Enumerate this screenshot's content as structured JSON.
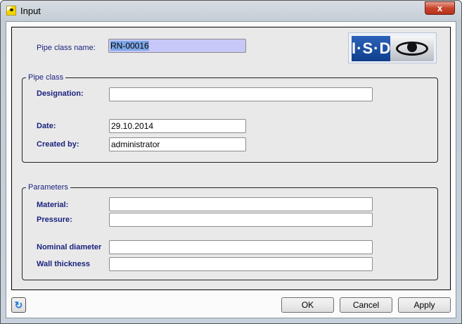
{
  "window": {
    "title": "Input",
    "close": "x"
  },
  "header": {
    "pipe_class_name_label": "Pipe class name:",
    "pipe_class_name_value": "RN-00016",
    "logo_text": "I·S·D"
  },
  "pipe_class": {
    "legend": "Pipe class",
    "designation_label": "Designation:",
    "designation_value": "",
    "date_label": "Date:",
    "date_value": "29.10.2014",
    "created_by_label": "Created by:",
    "created_by_value": "administrator"
  },
  "parameters": {
    "legend": "Parameters",
    "material_label": "Material:",
    "material_value": "",
    "pressure_label": "Pressure:",
    "pressure_value": "",
    "nominal_diameter_label": "Nominal diameter",
    "nominal_diameter_value": "",
    "wall_thickness_label": "Wall thickness",
    "wall_thickness_value": ""
  },
  "buttons": {
    "refresh": "↻",
    "ok": "OK",
    "cancel": "Cancel",
    "apply": "Apply"
  }
}
